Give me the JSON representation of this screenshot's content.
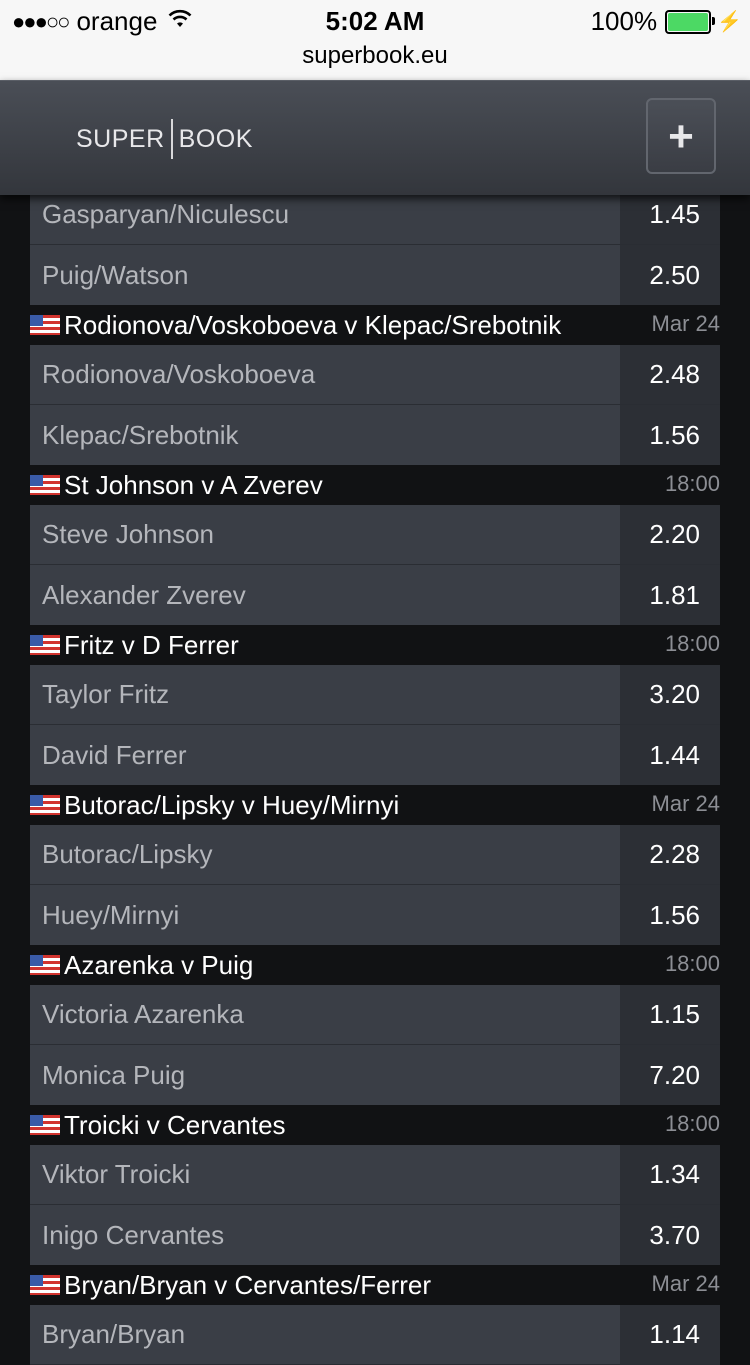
{
  "status_bar": {
    "carrier": "orange",
    "signal_dots": "●●●○○",
    "time": "5:02 AM",
    "battery": "100%",
    "url": "superbook.eu"
  },
  "header": {
    "logo_left": "SUPER",
    "logo_right": "BOOK",
    "add_label": "+"
  },
  "top_rows": [
    {
      "name": "Gasparyan/Niculescu",
      "odds": "1.45"
    },
    {
      "name": "Puig/Watson",
      "odds": "2.50"
    }
  ],
  "events": [
    {
      "title": "Rodionova/Voskoboeva v Klepac/Srebotnik",
      "time": "Mar 24",
      "rows": [
        {
          "name": "Rodionova/Voskoboeva",
          "odds": "2.48"
        },
        {
          "name": "Klepac/Srebotnik",
          "odds": "1.56"
        }
      ]
    },
    {
      "title": "St Johnson v A Zverev",
      "time": "18:00",
      "rows": [
        {
          "name": "Steve Johnson",
          "odds": "2.20"
        },
        {
          "name": "Alexander Zverev",
          "odds": "1.81"
        }
      ]
    },
    {
      "title": "Fritz v D Ferrer",
      "time": "18:00",
      "rows": [
        {
          "name": "Taylor Fritz",
          "odds": "3.20"
        },
        {
          "name": "David Ferrer",
          "odds": "1.44"
        }
      ]
    },
    {
      "title": "Butorac/Lipsky v Huey/Mirnyi",
      "time": "Mar 24",
      "rows": [
        {
          "name": "Butorac/Lipsky",
          "odds": "2.28"
        },
        {
          "name": "Huey/Mirnyi",
          "odds": "1.56"
        }
      ]
    },
    {
      "title": "Azarenka v Puig",
      "time": "18:00",
      "rows": [
        {
          "name": "Victoria Azarenka",
          "odds": "1.15"
        },
        {
          "name": "Monica Puig",
          "odds": "7.20"
        }
      ]
    },
    {
      "title": "Troicki v Cervantes",
      "time": "18:00",
      "rows": [
        {
          "name": "Viktor Troicki",
          "odds": "1.34"
        },
        {
          "name": "Inigo Cervantes",
          "odds": "3.70"
        }
      ]
    },
    {
      "title": "Bryan/Bryan v Cervantes/Ferrer",
      "time": "Mar 24",
      "rows": [
        {
          "name": "Bryan/Bryan",
          "odds": "1.14"
        }
      ]
    }
  ],
  "colors": {
    "background": "#111214",
    "row_bg": "#3a3e46",
    "odds_bg": "#2c2f35",
    "battery_green": "#4cd964"
  }
}
